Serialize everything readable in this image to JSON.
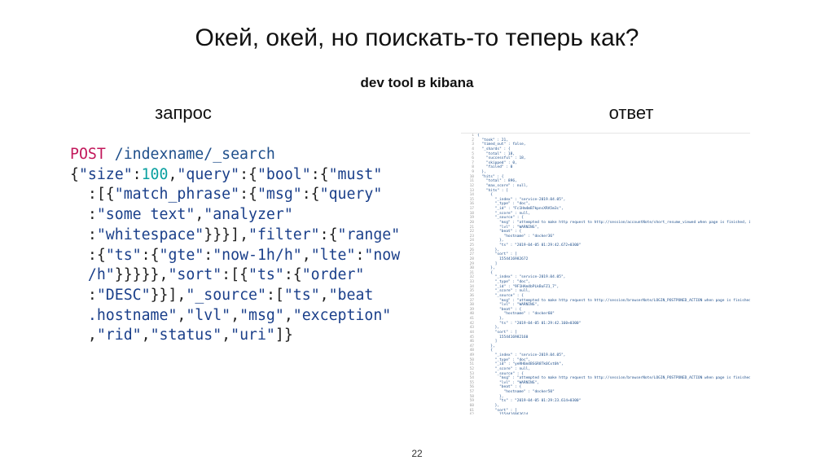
{
  "slide": {
    "title": "Окей, окей, но поискать-то теперь как?",
    "subtitle": "dev tool в kibana",
    "left_label": "запрос",
    "right_label": "ответ",
    "page_number": "22"
  },
  "request": {
    "lines": [
      [
        {
          "t": "POST",
          "c": "kw"
        },
        {
          "t": " /indexname/_search",
          "c": "path"
        }
      ],
      [
        {
          "t": "{",
          "c": "p"
        },
        {
          "t": "\"size\"",
          "c": "s"
        },
        {
          "t": ":",
          "c": "p"
        },
        {
          "t": "100",
          "c": "n"
        },
        {
          "t": ",",
          "c": "p"
        },
        {
          "t": "\"query\"",
          "c": "s"
        },
        {
          "t": ":{",
          "c": "p"
        },
        {
          "t": "\"bool\"",
          "c": "s"
        },
        {
          "t": ":{",
          "c": "p"
        },
        {
          "t": "\"must\"",
          "c": "s"
        }
      ],
      [
        {
          "t": "  :[{",
          "c": "p"
        },
        {
          "t": "\"match_phrase\"",
          "c": "s"
        },
        {
          "t": ":{",
          "c": "p"
        },
        {
          "t": "\"msg\"",
          "c": "s"
        },
        {
          "t": ":{",
          "c": "p"
        },
        {
          "t": "\"query\"",
          "c": "s"
        }
      ],
      [
        {
          "t": "  :",
          "c": "p"
        },
        {
          "t": "\"some text\"",
          "c": "s"
        },
        {
          "t": ",",
          "c": "p"
        },
        {
          "t": "\"analyzer\"",
          "c": "s"
        }
      ],
      [
        {
          "t": "  :",
          "c": "p"
        },
        {
          "t": "\"whitespace\"",
          "c": "s"
        },
        {
          "t": "}}}],",
          "c": "p"
        },
        {
          "t": "\"filter\"",
          "c": "s"
        },
        {
          "t": ":{",
          "c": "p"
        },
        {
          "t": "\"range\"",
          "c": "s"
        }
      ],
      [
        {
          "t": "  :{",
          "c": "p"
        },
        {
          "t": "\"ts\"",
          "c": "s"
        },
        {
          "t": ":{",
          "c": "p"
        },
        {
          "t": "\"gte\"",
          "c": "s"
        },
        {
          "t": ":",
          "c": "p"
        },
        {
          "t": "\"now-1h/h\"",
          "c": "s"
        },
        {
          "t": ",",
          "c": "p"
        },
        {
          "t": "\"lte\"",
          "c": "s"
        },
        {
          "t": ":",
          "c": "p"
        },
        {
          "t": "\"now",
          "c": "s"
        }
      ],
      [
        {
          "t": "  /h\"",
          "c": "s"
        },
        {
          "t": "}}}}},",
          "c": "p"
        },
        {
          "t": "\"sort\"",
          "c": "s"
        },
        {
          "t": ":[{",
          "c": "p"
        },
        {
          "t": "\"ts\"",
          "c": "s"
        },
        {
          "t": ":{",
          "c": "p"
        },
        {
          "t": "\"order\"",
          "c": "s"
        }
      ],
      [
        {
          "t": "  :",
          "c": "p"
        },
        {
          "t": "\"DESC\"",
          "c": "s"
        },
        {
          "t": "}}],",
          "c": "p"
        },
        {
          "t": "\"_source\"",
          "c": "s"
        },
        {
          "t": ":[",
          "c": "p"
        },
        {
          "t": "\"ts\"",
          "c": "s"
        },
        {
          "t": ",",
          "c": "p"
        },
        {
          "t": "\"beat",
          "c": "s"
        }
      ],
      [
        {
          "t": "  .hostname\"",
          "c": "s"
        },
        {
          "t": ",",
          "c": "p"
        },
        {
          "t": "\"lvl\"",
          "c": "s"
        },
        {
          "t": ",",
          "c": "p"
        },
        {
          "t": "\"msg\"",
          "c": "s"
        },
        {
          "t": ",",
          "c": "p"
        },
        {
          "t": "\"exception\"",
          "c": "s"
        }
      ],
      [
        {
          "t": "  ,",
          "c": "p"
        },
        {
          "t": "\"rid\"",
          "c": "s"
        },
        {
          "t": ",",
          "c": "p"
        },
        {
          "t": "\"status\"",
          "c": "s"
        },
        {
          "t": ",",
          "c": "p"
        },
        {
          "t": "\"uri\"",
          "c": "s"
        },
        {
          "t": "]}",
          "c": "p"
        }
      ]
    ]
  },
  "response": {
    "lines": [
      "{",
      "  \"took\" : 21,",
      "  \"timed_out\" : false,",
      "  \"_shards\" : {",
      "    \"total\" : 18,",
      "    \"successful\" : 18,",
      "    \"skipped\" : 0,",
      "    \"failed\" : 0",
      "  },",
      "  \"hits\" : {",
      "    \"total\" : 896,",
      "    \"max_score\" : null,",
      "    \"hits\" : [",
      "      {",
      "        \"_index\" : \"service-2019.04.05\",",
      "        \"_type\" : \"doc\",",
      "        \"_id\" : \"Fc1Hm4mB7kpnsXRA5m3c\",",
      "        \"_score\" : null,",
      "        \"_source\" : {",
      "          \"msg\" : \"attempted to make http request to http://session/accountNote/short_resume_viewed when page is finished, ignoring\",",
      "          \"lvl\" : \"WARNING\",",
      "          \"beat\" : {",
      "            \"hostname\" : \"docker36\"",
      "          },",
      "          \"ts\" : \"2019-04-05 01:29:42.672+0300\"",
      "        },",
      "        \"sort\" : [",
      "          1554416982672",
      "        ]",
      "      },",
      "      {",
      "        \"_index\" : \"service-2019.04.05\",",
      "        \"_type\" : \"doc\",",
      "        \"_id\" : \"9F1HAm4bPLkBuFZ1_7\",",
      "        \"_score\" : null,",
      "        \"_source\" : {",
      "          \"msg\" : \"attempted to make http request to http://session/browserNote/LOGIN_POSTPONED_ACTION when page is finished, ignoring\",",
      "          \"lvl\" : \"WARNING\",",
      "          \"beat\" : {",
      "            \"hostname\" : \"docker60\"",
      "          },",
      "          \"ts\" : \"2019-04-05 01:29:42.160+0300\"",
      "        },",
      "        \"sort\" : [",
      "          1554416982160",
      "        ]",
      "      },",
      "      {",
      "        \"_index\" : \"service-2019.04.05\",",
      "        \"_type\" : \"doc\",",
      "        \"_id\" : \"yeRH6m4BSGR8Tk0Cxt0h\",",
      "        \"_score\" : null,",
      "        \"_source\" : {",
      "          \"msg\" : \"attempted to make http request to http://session/browserNote/LOGIN_POSTPONED_ACTION when page is finished, ignoring\",",
      "          \"lvl\" : \"WARNING\",",
      "          \"beat\" : {",
      "            \"hostname\" : \"docker50\"",
      "          },",
      "          \"ts\" : \"2019-04-05 01:29:23.614+0300\"",
      "        },",
      "        \"sort\" : [",
      "          1554416963614",
      "        ]",
      "      },"
    ]
  }
}
